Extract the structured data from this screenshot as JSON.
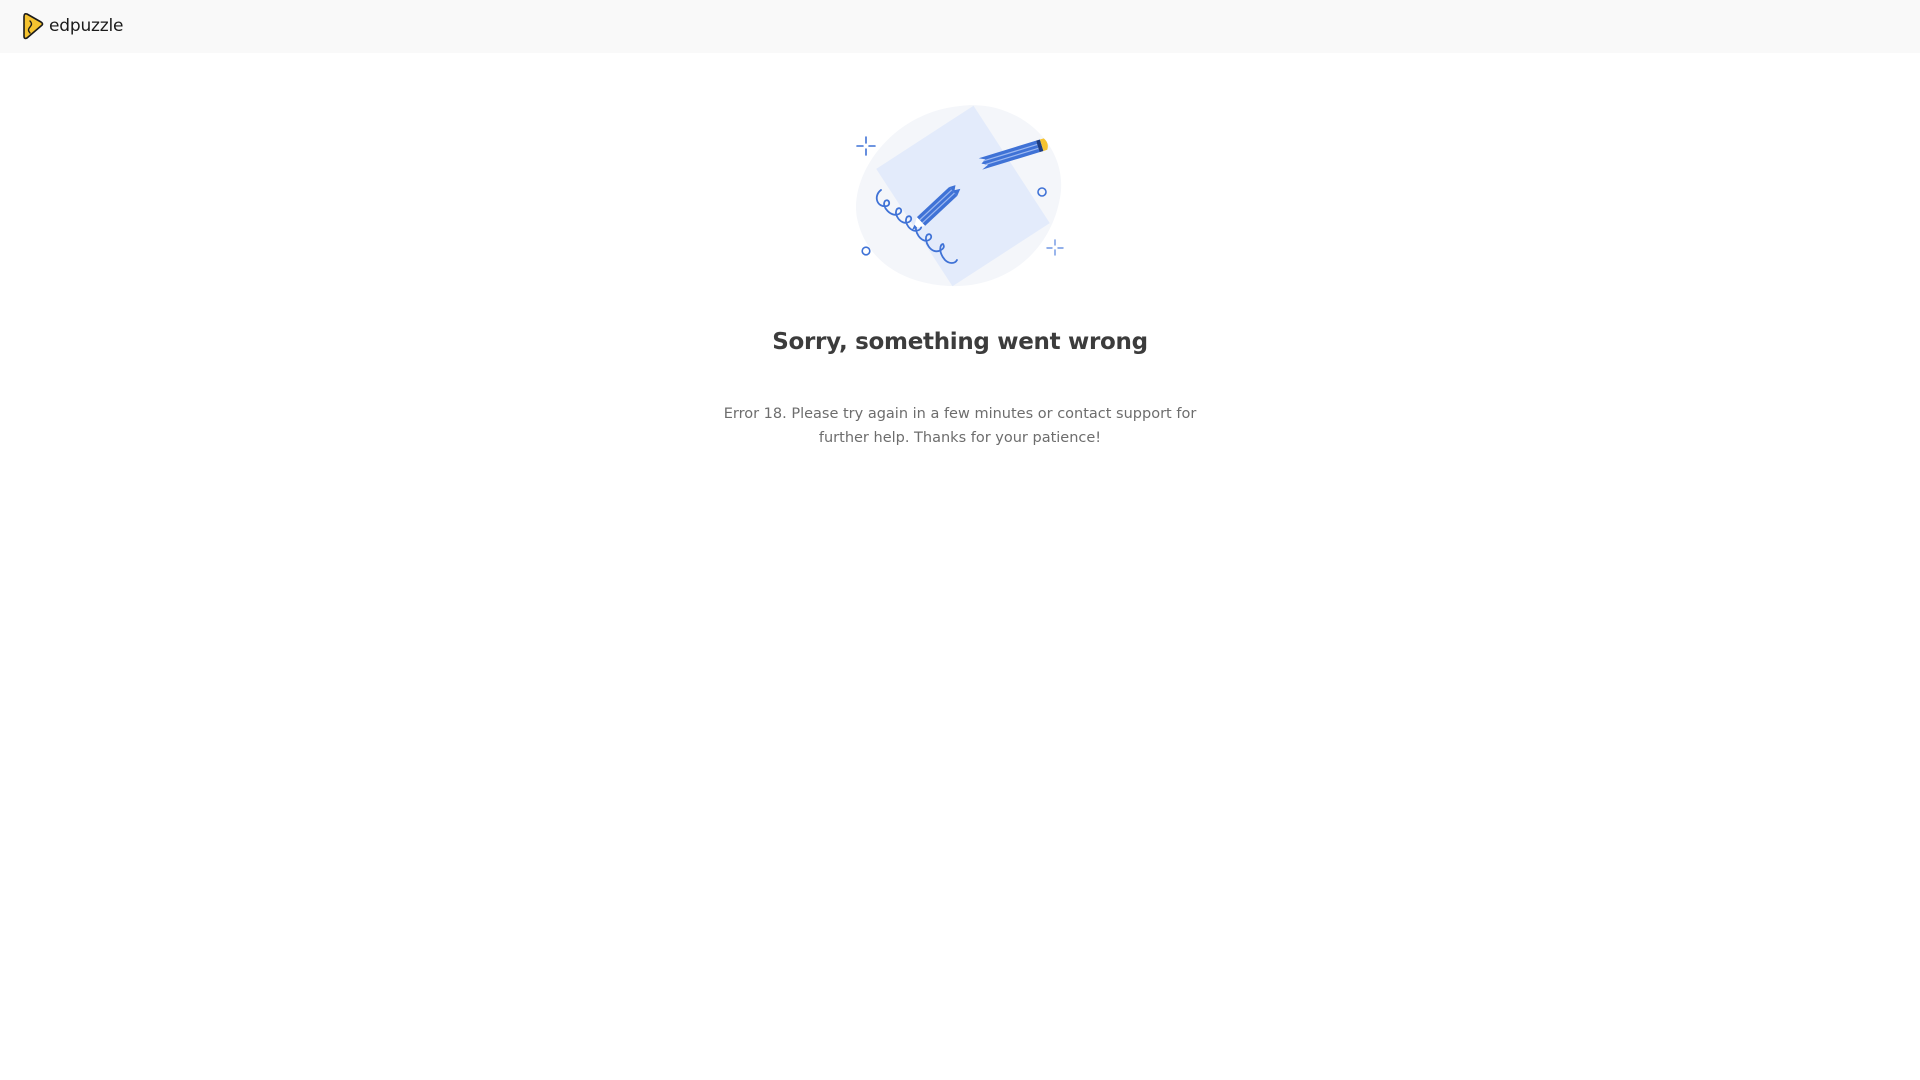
{
  "header": {
    "logo_text": "edpuzzle",
    "logo_icon": "edpuzzle-logo-icon"
  },
  "error": {
    "title": "Sorry, something went wrong",
    "message": "Error 18. Please try again in a few minutes or contact support for further help. Thanks for your patience!",
    "illustration_icon": "broken-pencil-illustration"
  },
  "colors": {
    "topbar_bg": "#f9f9f9",
    "accent_blue": "#3f72d6",
    "logo_yellow": "#f5c330",
    "paper_blue": "#e3ebfb",
    "blob_gray": "#f4f6fa"
  }
}
